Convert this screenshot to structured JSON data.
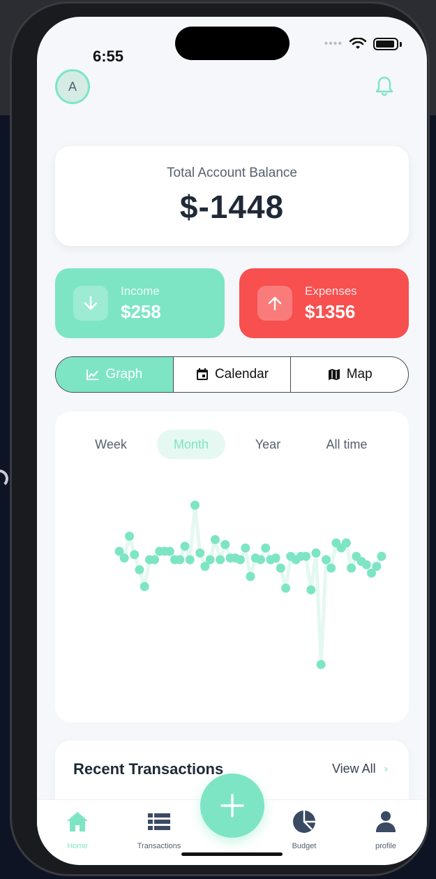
{
  "status_bar": {
    "time": "6:55"
  },
  "header": {
    "avatar_initial": "A"
  },
  "balance": {
    "label": "Total Account Balance",
    "value": "$-1448"
  },
  "income": {
    "label": "Income",
    "value": "$258"
  },
  "expenses": {
    "label": "Expenses",
    "value": "$1356"
  },
  "view_toggle": {
    "graph": "Graph",
    "calendar": "Calendar",
    "map": "Map",
    "active": "Graph"
  },
  "periods": {
    "week": "Week",
    "month": "Month",
    "year": "Year",
    "all_time": "All time",
    "active": "Month"
  },
  "chart_data": {
    "type": "line",
    "title": "",
    "xlabel": "",
    "ylabel": "",
    "x": [
      1,
      2,
      3,
      4,
      5,
      6,
      7,
      8,
      9,
      10,
      11,
      12,
      13,
      14,
      15,
      16,
      17,
      18,
      19,
      20,
      21,
      22,
      23,
      24,
      25,
      26,
      27,
      28,
      29,
      30,
      31,
      32,
      33,
      34,
      35,
      36,
      37,
      38,
      39,
      40,
      41,
      42,
      43,
      44,
      45,
      46,
      47,
      48,
      49,
      50,
      51,
      52,
      53,
      54,
      55
    ],
    "series": [
      {
        "values": [
          0,
          -8,
          18,
          -4,
          -22,
          -42,
          -10,
          -10,
          0,
          0,
          0,
          -10,
          -10,
          6,
          -10,
          55,
          -2,
          -18,
          -10,
          14,
          -10,
          8,
          -8,
          -8,
          -10,
          4,
          -30,
          -8,
          -10,
          4,
          -10,
          -8,
          -20,
          -44,
          -6,
          -10,
          -6,
          -6,
          -46,
          -2,
          -135,
          -10,
          -20,
          10,
          4,
          10,
          -20,
          -6,
          -12,
          -16,
          -26,
          -18,
          -6
        ],
        "x": [
          1,
          2,
          3,
          4,
          5,
          6,
          7,
          8,
          9,
          10,
          11,
          12,
          13,
          14,
          15,
          16,
          17,
          18,
          19,
          20,
          21,
          22,
          23,
          24,
          25,
          26,
          27,
          28,
          29,
          30,
          31,
          32,
          33,
          34,
          35,
          36,
          37,
          38,
          39,
          40,
          41,
          42,
          43,
          44,
          45,
          46,
          47,
          48,
          49,
          50,
          51,
          52,
          53
        ]
      }
    ],
    "grid": false,
    "legend": "none"
  },
  "recent": {
    "title": "Recent Transactions",
    "view_all": "View All"
  },
  "tabs": {
    "home": "Home",
    "transactions": "Transactions",
    "budget": "Budget",
    "profile": "profile"
  },
  "colors": {
    "accent": "#7de5c4",
    "expense": "#f7504f",
    "text": "#1f2937"
  }
}
